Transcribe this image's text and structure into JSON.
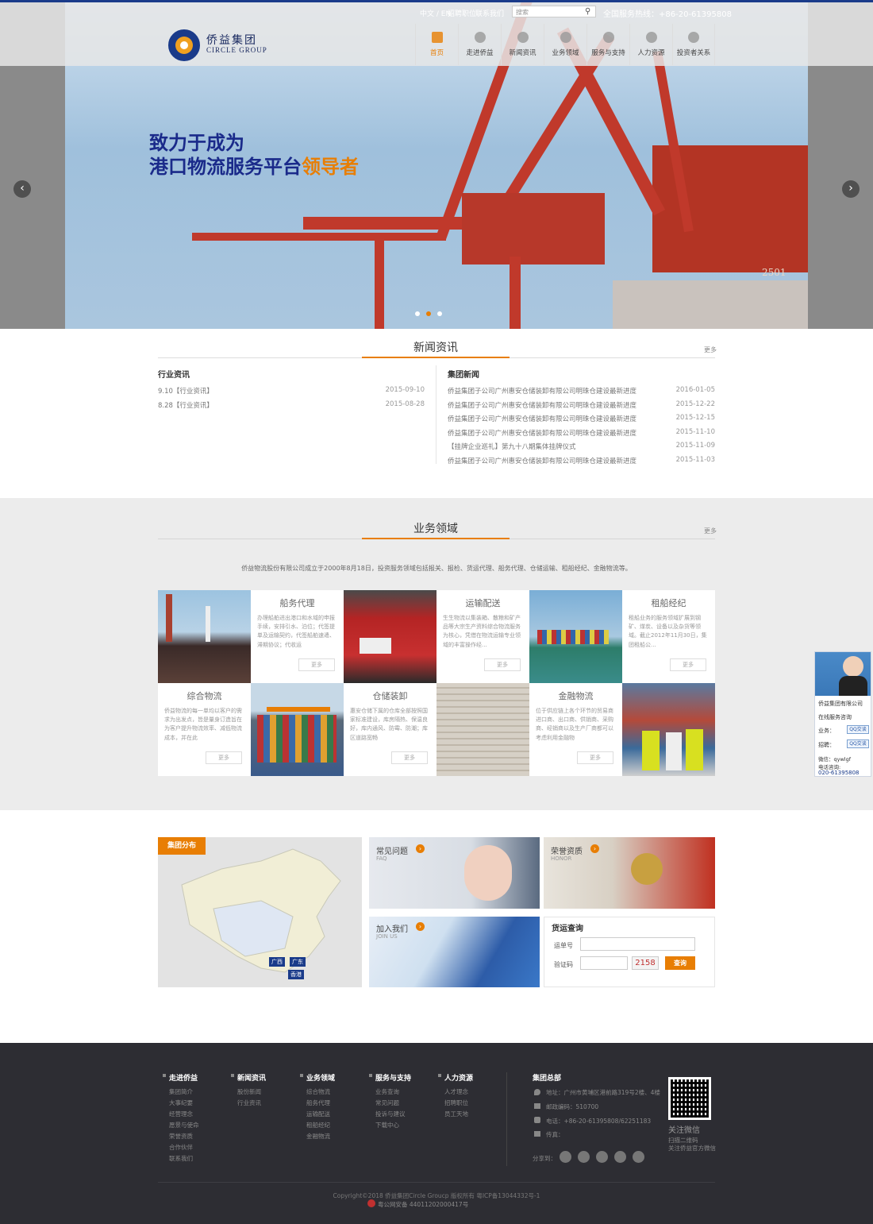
{
  "header": {
    "lang": "中文 / EN",
    "recruit": "招聘职位",
    "contact": "联系我们",
    "search_placeholder": "搜索",
    "hotline": "全国服务热线：+86-20-61395808",
    "logo_cn": "侨益集团",
    "logo_en": "CIRCLE GROUP",
    "nav": [
      {
        "label": "首页",
        "icon": "home-icon",
        "active": true
      },
      {
        "label": "走进侨益",
        "icon": "gear-icon"
      },
      {
        "label": "新闻资讯",
        "icon": "globe-icon"
      },
      {
        "label": "业务领域",
        "icon": "location-pin-icon"
      },
      {
        "label": "服务与支持",
        "icon": "atom-icon"
      },
      {
        "label": "人力资源",
        "icon": "handshake-icon"
      },
      {
        "label": "投资者关系",
        "icon": "person-icon"
      }
    ]
  },
  "hero": {
    "slogan_line1": "致力于成为",
    "slogan_line2a": "港口物流服务平台",
    "slogan_line2b": "领导者",
    "crane_number": "2501"
  },
  "news": {
    "title": "新闻资讯",
    "more": "更多",
    "industry_title": "行业资讯",
    "industry": [
      {
        "title": "9.10【行业资讯】",
        "date": "2015-09-10"
      },
      {
        "title": "8.28【行业资讯】",
        "date": "2015-08-28"
      }
    ],
    "group_title": "集团新闻",
    "group": [
      {
        "title": "侨益集团子公司广州惠安仓储装卸有限公司明珠仓建设最新进度",
        "date": "2016-01-05"
      },
      {
        "title": "侨益集团子公司广州惠安仓储装卸有限公司明珠仓建设最新进度",
        "date": "2015-12-22"
      },
      {
        "title": "侨益集团子公司广州惠安仓储装卸有限公司明珠仓建设最新进度",
        "date": "2015-12-15"
      },
      {
        "title": "侨益集团子公司广州惠安仓储装卸有限公司明珠仓建设最新进度",
        "date": "2015-11-10"
      },
      {
        "title": "【挂牌企业巡礼】第九十八期集体挂牌仪式",
        "date": "2015-11-09"
      },
      {
        "title": "侨益集团子公司广州惠安仓储装卸有限公司明珠仓建设最新进度",
        "date": "2015-11-03"
      }
    ]
  },
  "business": {
    "title": "业务领域",
    "more": "更多",
    "intro": "侨益物流股份有限公司成立于2000年8月18日，投资服务领域包括报关、报检、货运代理、船务代理、仓储运输、租船经纪、金融物流等。",
    "tiles": [
      {
        "title": "船务代理",
        "desc": "办理船舶进出港口和水域的申报手续，安排引水、泊位；代签提单及运输契约，代签船舶速遣、滞期协议；代收运",
        "more": "更多"
      },
      {
        "title": "运输配送",
        "desc": "生生物流以集装箱、散粮和矿产品等大宗生产资料综合物流服务为核心，凭借在物流运输专业领域的丰富操作经...",
        "more": "更多"
      },
      {
        "title": "租船经纪",
        "desc": "租船业务的服务领域扩展到钢矿、煤炭、设备以及杂货等领域。截止2012年11月30日，集团租船公...",
        "more": "更多"
      },
      {
        "title": "综合物流",
        "desc": "侨益物流的每一单均以客户的需求为出发点，皆是量身订造旨在为客户提升物流效率、减低物流成本，并在此",
        "more": "更多"
      },
      {
        "title": "仓储装卸",
        "desc": "惠安仓储下属的仓库全部按照国家标准建设，库房隔热、保温良好，库内通风、防霉、防潮；库区道路宽畅",
        "more": "更多"
      },
      {
        "title": "金融物流",
        "desc": "位于供应链上各个环节的贸易商进口商、出口商、供销商、采购商、经销商以及生产厂商都可以考虑利用金融物",
        "more": "更多"
      }
    ]
  },
  "bottom": {
    "map_title": "集团分布",
    "map_labels": [
      "广西",
      "广东",
      "香港"
    ],
    "faq": "常见问题",
    "faq_en": "FAQ",
    "honor": "荣誉资质",
    "honor_en": "HONOR",
    "join": "加入我们",
    "join_en": "JOIN US",
    "tracking_title": "货运查询",
    "waybill_label": "运单号",
    "code_label": "验证码",
    "captcha": "2158",
    "query_button": "查询"
  },
  "service": {
    "company": "侨益集团有限公司",
    "online": "在线服务咨询",
    "business_label": "业务：",
    "recruit_label": "招聘：",
    "qq_badge": "QQ交谈",
    "wechat": "微信：qywlgf",
    "phone_label": "电话咨询:",
    "phone": "020-61395808"
  },
  "footer": {
    "columns": [
      {
        "title": "走进侨益",
        "items": [
          "集团简介",
          "大事纪要",
          "经营理念",
          "愿景与使命",
          "荣誉资质",
          "合作伙伴",
          "联系我们"
        ]
      },
      {
        "title": "新闻资讯",
        "items": [
          "股份新闻",
          "行业资讯"
        ]
      },
      {
        "title": "业务领域",
        "items": [
          "综合物流",
          "船务代理",
          "运输配送",
          "租船经纪",
          "金融物流"
        ]
      },
      {
        "title": "服务与支持",
        "items": [
          "业务查询",
          "常见问题",
          "投诉与建议",
          "下载中心"
        ]
      },
      {
        "title": "人力资源",
        "items": [
          "人才理念",
          "招聘职位",
          "员工天地"
        ]
      }
    ],
    "hq_title": "集团总部",
    "address": "地址：广州市黄埔区港前路319号2楼、4楼",
    "postcode": "邮政编码：510700",
    "phone": "电话：+86-20-61395808/62251183",
    "fax": "传真：",
    "share": "分享到：",
    "follow": "关注微信",
    "scan": "扫描二维码",
    "follow_sub": "关注侨益官方微信",
    "copyright": "Copyright©2018 侨益集团Circle Groucp 版权所有 粤ICP备13044332号-1",
    "police": "粤公网安备 44011202000417号"
  }
}
